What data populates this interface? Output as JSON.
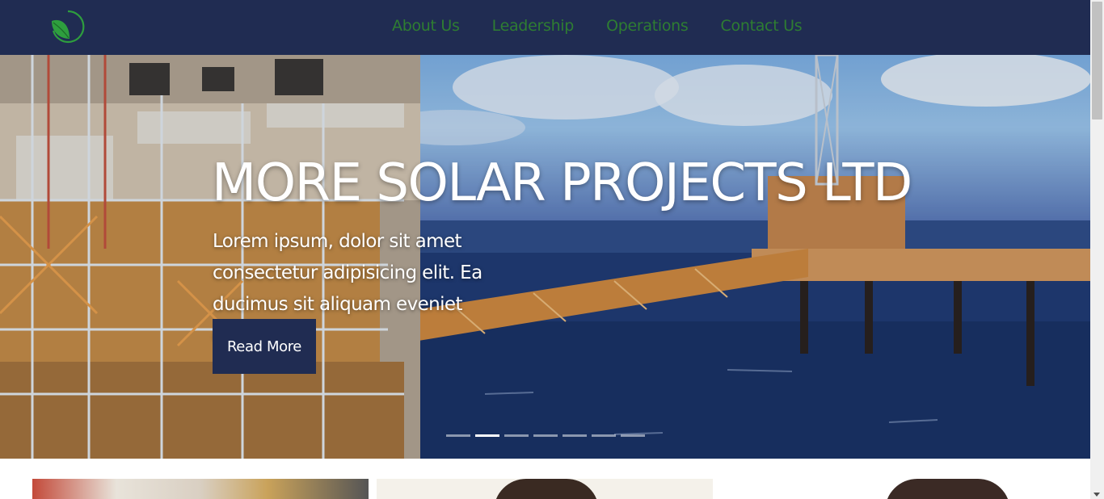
{
  "nav": {
    "links": [
      "About Us",
      "Leadership",
      "Operations",
      "Contact Us"
    ]
  },
  "hero": {
    "title": "MORE SOLAR PROJECTS LTD",
    "text": "Lorem ipsum, dolor sit amet consectetur adipisicing elit.  Ea ducimus sit aliquam eveniet odit.",
    "button_label": "Read More",
    "slide_count": 7,
    "active_slide": 2
  },
  "colors": {
    "navbar": "#202c52",
    "nav_link": "#2e7d32",
    "button": "#202c52",
    "logo": "#2e9e3e"
  },
  "icons": {
    "logo": "leaf-logo-icon"
  }
}
